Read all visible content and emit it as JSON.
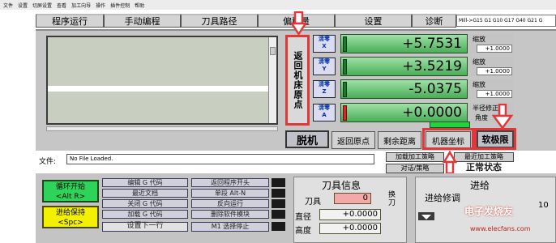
{
  "menu": [
    "文件",
    "设置",
    "切屏设置",
    "查看",
    "加工向导",
    "操作",
    "插件控制",
    "帮助"
  ],
  "tabs": [
    "程序运行",
    "手动编程",
    "刀具路径",
    "偏移量",
    "设置",
    "诊断"
  ],
  "gcode_status": "Mill->G15  G1 G10 G17 G40 G21 G",
  "ref_all_home": "返回机床原点",
  "axes": [
    {
      "zero_label": "清零",
      "axis": "X",
      "value": "+5.7531",
      "scale_label": "缩放",
      "scale": "+1.0000",
      "led": "green"
    },
    {
      "zero_label": "清零",
      "axis": "Y",
      "value": "+3.5219",
      "scale_label": "缩放",
      "scale": "+1.0000",
      "led": "green"
    },
    {
      "zero_label": "清零",
      "axis": "Z",
      "value": "-5.0375",
      "scale_label": "缩放",
      "scale": "+1.0000",
      "led": "green"
    },
    {
      "zero_label": "清零",
      "axis": "A",
      "value": "+0.0000",
      "scale_label": "半径修正",
      "scale": "角度",
      "led": "red"
    }
  ],
  "buttons": {
    "offline": "脱机",
    "goto_zero": "返回原点",
    "remaining": "剩余距离",
    "machine_coords": "机器坐标",
    "soft_limits": "软极限",
    "load_wizard": "加载加工策略",
    "last_wizard": "最近加工策略",
    "conversational": "对话/策略",
    "normal_state": "正常状态"
  },
  "file": {
    "label": "文件:",
    "value": "No File Loaded."
  },
  "cycle_start": {
    "line1": "循环开始",
    "line2": "<Alt R>"
  },
  "feed_hold": {
    "line1": "进给保持",
    "line2": "<Spc>"
  },
  "menu_buttons_left": [
    "编辑 G 代码",
    "最近文档",
    "关闭 G 代码",
    "加载 G 代码",
    "设置下一行"
  ],
  "menu_buttons_mid": [
    "返回程序开头",
    "单段 Alt-N",
    "反向运行",
    "删除软件模块",
    "M1 选择停止"
  ],
  "tool_info": {
    "title": "刀具信息",
    "tool_label": "刀具",
    "tool_value": "0",
    "change_label": "换刀",
    "dia_label": "直径",
    "dia_value": "+0.0000",
    "height_label": "高度",
    "height_value": "+0.0000"
  },
  "feed": {
    "title": "进给",
    "override_label": "进给修调",
    "value": "10"
  },
  "watermark": "电子发烧友",
  "watermark_url": "www.elecfans.com"
}
